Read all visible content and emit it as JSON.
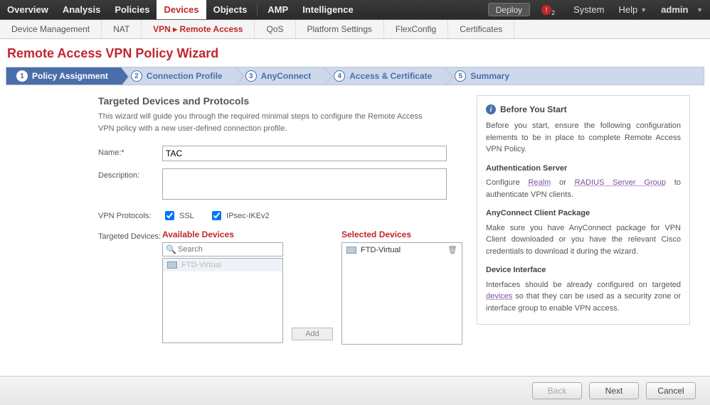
{
  "topnav": {
    "items": [
      "Overview",
      "Analysis",
      "Policies",
      "Devices",
      "Objects",
      "AMP",
      "Intelligence"
    ],
    "active_index": 3,
    "deploy": "Deploy",
    "alert_count": "2",
    "system": "System",
    "help": "Help",
    "user": "admin"
  },
  "subnav": {
    "items": [
      {
        "label": "Device Management"
      },
      {
        "label": "NAT"
      },
      {
        "label": "VPN ▸ Remote Access",
        "active": true
      },
      {
        "label": "QoS"
      },
      {
        "label": "Platform Settings"
      },
      {
        "label": "FlexConfig"
      },
      {
        "label": "Certificates"
      }
    ]
  },
  "page": {
    "title": "Remote Access VPN Policy Wizard"
  },
  "wizard": {
    "steps": [
      "Policy Assignment",
      "Connection Profile",
      "AnyConnect",
      "Access & Certificate",
      "Summary"
    ],
    "active_index": 0
  },
  "form": {
    "section_title": "Targeted Devices and Protocols",
    "section_desc": "This wizard will guide you through the required minimal steps to configure the Remote Access VPN policy with a new user-defined connection profile.",
    "name_label": "Name:*",
    "name_value": "TAC",
    "desc_label": "Description:",
    "desc_value": "",
    "proto_label": "VPN Protocols:",
    "proto_ssl": "SSL",
    "proto_ssl_checked": true,
    "proto_ipsec": "IPsec-IKEv2",
    "proto_ipsec_checked": true,
    "targeted_label": "Targeted Devices:",
    "available_hdr": "Available Devices",
    "selected_hdr": "Selected Devices",
    "search_placeholder": "Search",
    "available_list": [
      {
        "label": "FTD-Virtual",
        "disabled": true
      }
    ],
    "selected_list": [
      {
        "label": "FTD-Virtual"
      }
    ],
    "add_btn": "Add"
  },
  "sidebox": {
    "title": "Before You Start",
    "intro": "Before you start, ensure the following configuration elements to be in place to complete Remote Access VPN Policy.",
    "auth_hdr": "Authentication Server",
    "auth_pre": "Configure ",
    "auth_link1": "Realm",
    "auth_mid": " or ",
    "auth_link2": "RADIUS Server Group",
    "auth_post": " to authenticate VPN clients.",
    "any_hdr": "AnyConnect Client Package",
    "any_txt": "Make sure you have AnyConnect package for VPN Client downloaded or you have the relevant Cisco credentials to download it during the wizard.",
    "dev_hdr": "Device Interface",
    "dev_pre": "Interfaces should be already configured on targeted ",
    "dev_link": "devices",
    "dev_post": " so that they can be used as a security zone or interface group to enable VPN access."
  },
  "footer": {
    "back": "Back",
    "next": "Next",
    "cancel": "Cancel"
  }
}
